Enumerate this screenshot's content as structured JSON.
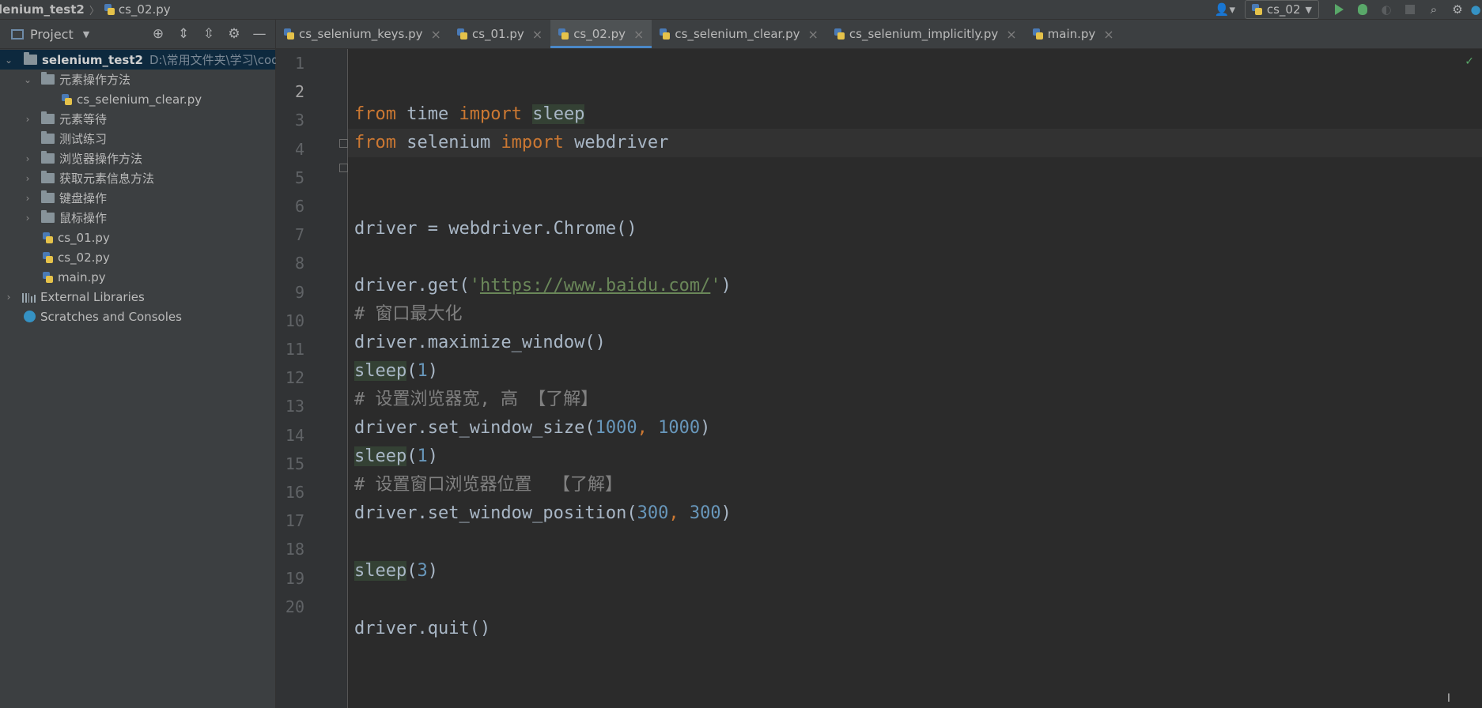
{
  "breadcrumb": {
    "project": "lenium_test2",
    "file": "cs_02.py"
  },
  "run_config": {
    "name": "cs_02"
  },
  "project_panel": {
    "title": "Project",
    "root": {
      "name": "selenium_test2",
      "path": "D:\\常用文件夹\\学习\\code\\"
    },
    "items": [
      {
        "label": "元素操作方法"
      },
      {
        "label": "cs_selenium_clear.py"
      },
      {
        "label": "元素等待"
      },
      {
        "label": "测试练习"
      },
      {
        "label": "浏览器操作方法"
      },
      {
        "label": "获取元素信息方法"
      },
      {
        "label": "键盘操作"
      },
      {
        "label": "鼠标操作"
      },
      {
        "label": "cs_01.py"
      },
      {
        "label": "cs_02.py"
      },
      {
        "label": "main.py"
      },
      {
        "label": "External Libraries"
      },
      {
        "label": "Scratches and Consoles"
      }
    ]
  },
  "tabs": [
    {
      "label": "cs_selenium_keys.py"
    },
    {
      "label": "cs_01.py"
    },
    {
      "label": "cs_02.py",
      "active": true
    },
    {
      "label": "cs_selenium_clear.py"
    },
    {
      "label": "cs_selenium_implicitly.py"
    },
    {
      "label": "main.py"
    }
  ],
  "editor": {
    "current_line": 2,
    "line_numbers": [
      "1",
      "2",
      "3",
      "4",
      "5",
      "6",
      "7",
      "8",
      "9",
      "10",
      "11",
      "12",
      "13",
      "14",
      "15",
      "16",
      "17",
      "18",
      "19",
      "20"
    ],
    "code": {
      "l2_kw1": "from",
      "l2_mod": " time ",
      "l2_kw2": "import",
      "l2_sp": " ",
      "l2_name": "sleep",
      "l3_kw1": "from",
      "l3_mod": " selenium ",
      "l3_kw2": "import",
      "l3_name": " webdriver",
      "l5": "driver = webdriver.Chrome()",
      "l7_a": "driver.get(",
      "l7_q1": "'",
      "l7_url": "https://www.baidu.com/",
      "l7_q2": "'",
      "l7_b": ")",
      "l8": "# 窗口最大化",
      "l9": "driver.maximize_window()",
      "l10_fn": "sleep",
      "l10_a": "(",
      "l10_n": "1",
      "l10_b": ")",
      "l11": "# 设置浏览器宽, 高 【了解】",
      "l12_a": "driver.set_window_size(",
      "l12_n1": "1000",
      "l12_c": ", ",
      "l12_n2": "1000",
      "l12_b": ")",
      "l13_fn": "sleep",
      "l13_a": "(",
      "l13_n": "1",
      "l13_b": ")",
      "l14": "# 设置窗口浏览器位置  【了解】",
      "l15_a": "driver.set_window_position(",
      "l15_n1": "300",
      "l15_c": ", ",
      "l15_n2": "300",
      "l15_b": ")",
      "l17_fn": "sleep",
      "l17_a": "(",
      "l17_n": "3",
      "l17_b": ")",
      "l19": "driver.quit()"
    }
  },
  "icons": {
    "user": "user-icon",
    "run": "run-icon",
    "debug": "debug-icon",
    "coverage": "coverage-icon",
    "stop": "stop-icon",
    "search": "search-icon",
    "settings": "gear-icon"
  },
  "colors": {
    "keyword": "#cc7832",
    "number": "#6897bb",
    "string": "#6a8759",
    "comment": "#808080",
    "accent": "#4a88c7"
  }
}
